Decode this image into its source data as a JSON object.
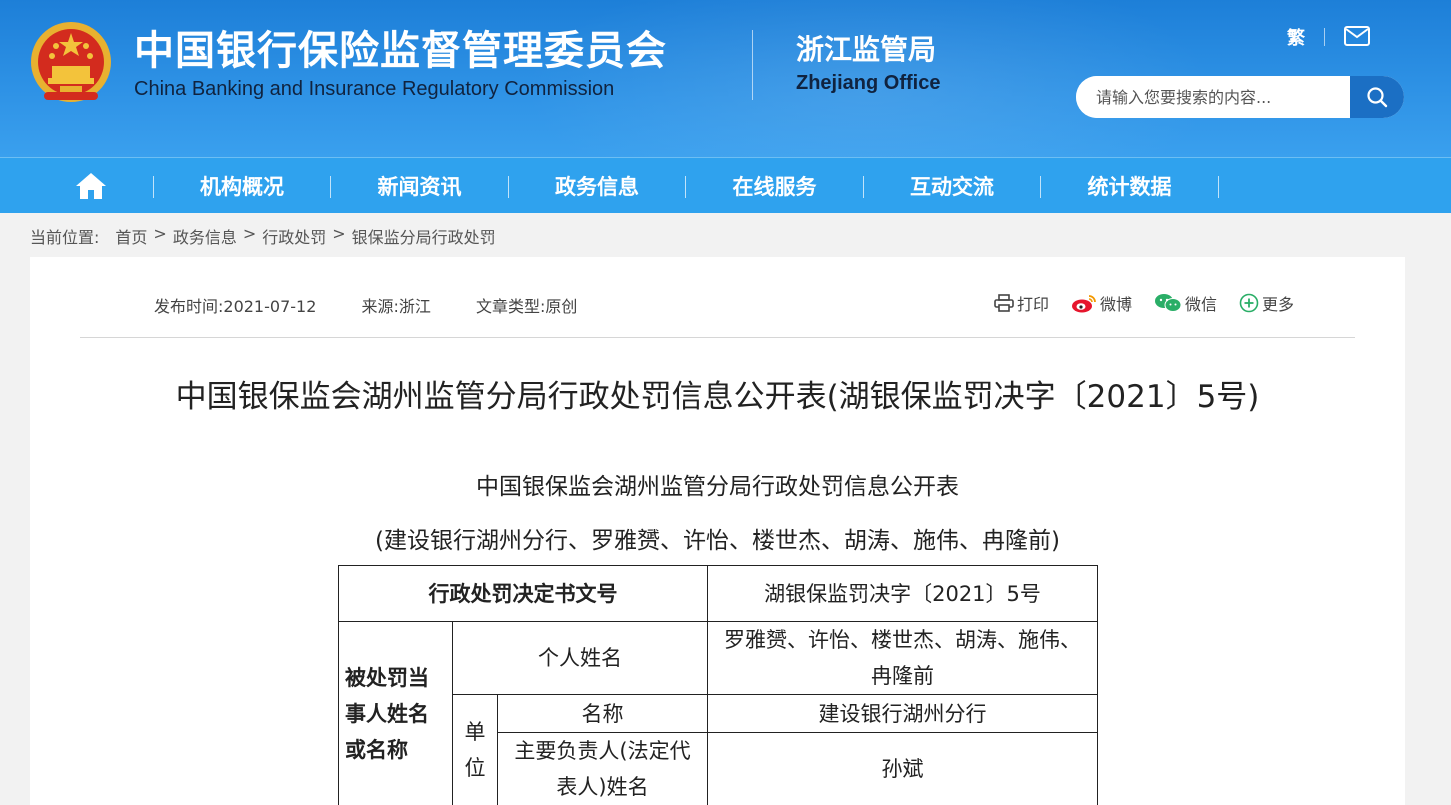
{
  "header": {
    "org_cn": "中国银行保险监督管理委员会",
    "org_en": "China Banking and Insurance Regulatory Commission",
    "office_cn": "浙江监管局",
    "office_en": "Zhejiang Office",
    "traditional_label": "繁",
    "mail_icon": "mail-icon",
    "search_placeholder": "请输入您要搜索的内容...",
    "search_icon": "search-icon"
  },
  "nav": {
    "home_icon": "home-icon",
    "items": [
      "机构概况",
      "新闻资讯",
      "政务信息",
      "在线服务",
      "互动交流",
      "统计数据"
    ]
  },
  "breadcrumb": {
    "label": "当前位置:",
    "items": [
      "首页",
      "政务信息",
      "行政处罚",
      "银保监分局行政处罚"
    ],
    "separator": ">"
  },
  "article": {
    "publish_time": "发布时间:2021-07-12",
    "source": "来源:浙江",
    "type": "文章类型:原创",
    "tools": {
      "print": "打印",
      "weibo": "微博",
      "wechat": "微信",
      "more": "更多"
    },
    "title": "中国银保监会湖州监管分局行政处罚信息公开表(湖银保监罚决字〔2021〕5号)",
    "subtitle1": "中国银保监会湖州监管分局行政处罚信息公开表",
    "subtitle2": "(建设银行湖州分行、罗雅赟、许怡、楼世杰、胡涛、施伟、冉隆前)",
    "table": {
      "decision_no_label": "行政处罚决定书文号",
      "decision_no_value": "湖银保监罚决字〔2021〕5号",
      "party_label": "被处罚当事人姓名或名称",
      "person_name_label": "个人姓名",
      "person_name_value": "罗雅赟、许怡、楼世杰、胡涛、施伟、冉隆前",
      "unit_label": "单位",
      "unit_name_label": "名称",
      "unit_name_value": "建设银行湖州分行",
      "legal_rep_label": "主要负责人(法定代表人)姓名",
      "legal_rep_value": "孙斌"
    }
  },
  "colors": {
    "header_blue": "#1d7fd8",
    "nav_blue": "#2fa2ee",
    "search_btn": "#1b6fc4"
  }
}
